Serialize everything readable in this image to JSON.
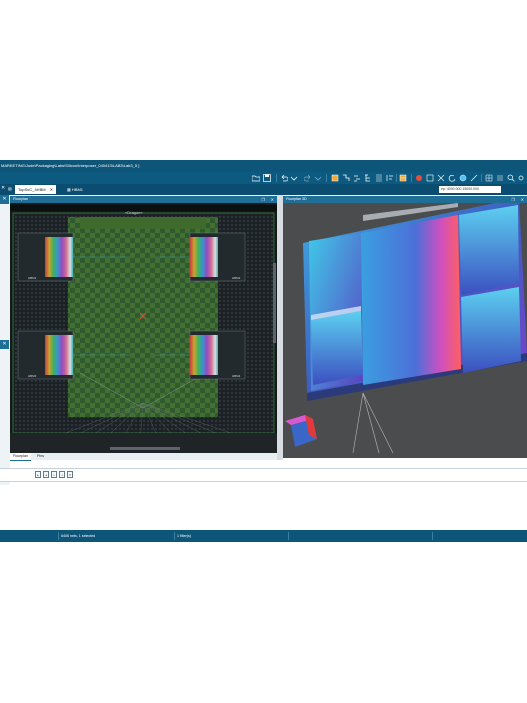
{
  "window": {
    "title_path": "MARKETING\\Jude\\Packaging\\Labs\\Silicon\\Interposer_040413\\LAB3\\Lab3_5 ]"
  },
  "tabs": [
    {
      "label": "TopSoC_4HBM",
      "active": true
    },
    {
      "label": "HBM1",
      "active": false
    }
  ],
  "coordinate_readout": "ep: 4000.000   15000.000",
  "panels": {
    "floorplan_2d": {
      "title": "Floorplan"
    },
    "floorplan_3d": {
      "title": "Floorplan 3D"
    }
  },
  "floorplan_2d": {
    "top_label": "»Dragon«",
    "die_labels": [
      "HBM1",
      "HBM2",
      "HBM3",
      "HBM4"
    ]
  },
  "bottom_tabs": [
    {
      "label": "Floorplan",
      "active": true
    },
    {
      "label": "Pins",
      "active": false
    }
  ],
  "console": {
    "buttons": [
      "▸",
      "◂",
      "▹",
      "◃",
      "✕"
    ]
  },
  "status": {
    "nets": "6406 nets, 1 selected",
    "filters": "1 filter(s)"
  },
  "colors": {
    "titlebar": "#0e5679",
    "panel_header": "#1f6e96",
    "floorplan_bg": "#15191b",
    "view3d_bg": "#4a4c4d"
  }
}
